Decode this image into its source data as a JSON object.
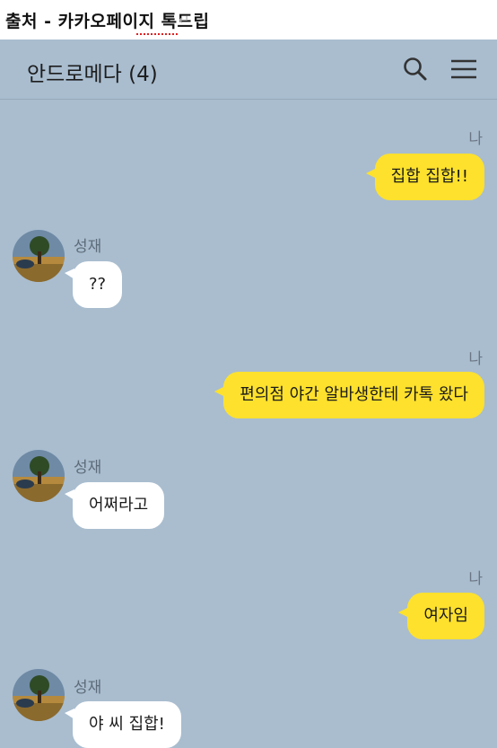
{
  "source_caption": "출처 - 카카오페이지 톡드립",
  "header": {
    "title": "안드로메다 (4)",
    "search_icon": "search-icon",
    "menu_icon": "menu-icon"
  },
  "messages": [
    {
      "type": "mine",
      "sender": "나",
      "text": "집합 집합!!"
    },
    {
      "type": "theirs",
      "sender": "성재",
      "text": "??"
    },
    {
      "type": "mine",
      "sender": "나",
      "text": "편의점 야간 알바생한테 카톡 왔다"
    },
    {
      "type": "theirs",
      "sender": "성재",
      "text": "어쩌라고"
    },
    {
      "type": "mine",
      "sender": "나",
      "text": "여자임"
    },
    {
      "type": "theirs",
      "sender": "성재",
      "text": "야 씨 집합!"
    }
  ],
  "colors": {
    "background": "#a9bdcf",
    "my_bubble": "#fde12d",
    "their_bubble": "#ffffff"
  }
}
